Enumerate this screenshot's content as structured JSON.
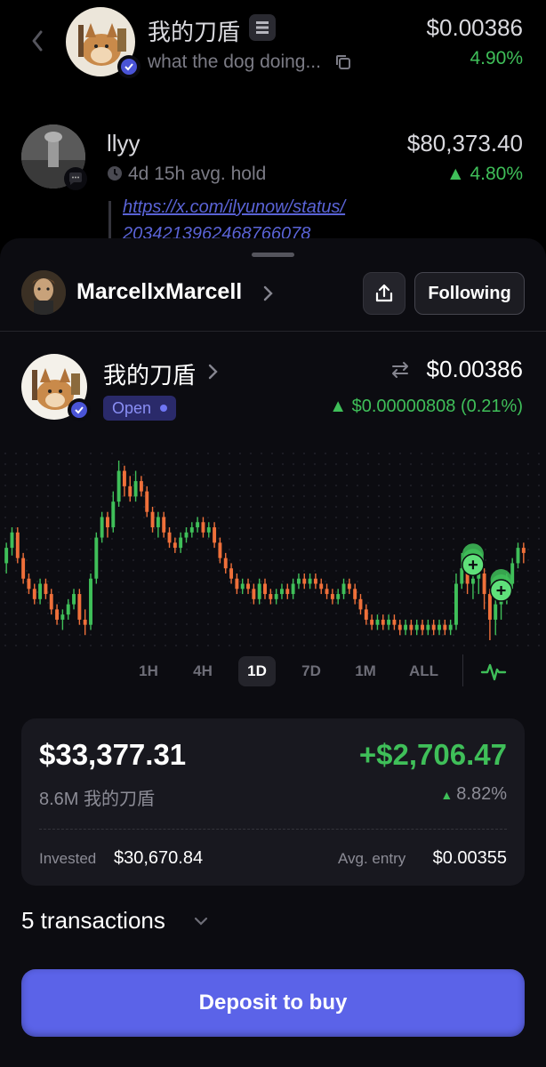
{
  "feed": {
    "items": [
      {
        "title": "我的刀盾",
        "subtitle": "what the dog doing...",
        "price": "$0.00386",
        "change": "4.90%"
      },
      {
        "title": "llyy",
        "subtitle": "4d 15h avg. hold",
        "price": "$80,373.40",
        "change": "▲ 4.80%",
        "link_line1": "https://x.com/ilyunow/status/",
        "link_line2": "2034213962468766078"
      }
    ]
  },
  "sheet": {
    "user": {
      "name": "MarcellxMarcell",
      "follow_label": "Following"
    },
    "token": {
      "name": "我的刀盾",
      "status": "Open",
      "price": "$0.00386",
      "delta": "▲ $0.00000808 (0.21%)"
    },
    "ranges": [
      "1H",
      "4H",
      "1D",
      "7D",
      "1M",
      "ALL"
    ],
    "active_range": "1D",
    "position": {
      "value": "$33,377.31",
      "pnl": "+$2,706.47",
      "amount": "8.6M 我的刀盾",
      "pnl_pct": "8.82%",
      "invested_label": "Invested",
      "invested": "$30,670.84",
      "avg_entry_label": "Avg. entry",
      "avg_entry": "$0.00355"
    },
    "transactions_label": "5 transactions",
    "deposit_label": "Deposit to buy"
  },
  "colors": {
    "accent": "#5b63e8",
    "up": "#3fbf59",
    "down": "#f0703a",
    "sheet_bg": "#0c0c11",
    "card_bg": "#18181f"
  },
  "icons": [
    "back-chevron-icon",
    "solana-icon",
    "copy-icon",
    "clock-icon",
    "chat-bubble-icon",
    "verified-icon",
    "chevron-right-icon",
    "share-icon",
    "swap-icon",
    "pulse-icon",
    "chevron-down-icon",
    "buy-marker-icon"
  ],
  "chart_data": {
    "type": "candlestick",
    "timeframe": "1D",
    "y_unit": "price index (relative)",
    "candles": [
      [
        52,
        58,
        48,
        60
      ],
      [
        58,
        64,
        55,
        66
      ],
      [
        64,
        54,
        52,
        66
      ],
      [
        54,
        46,
        44,
        56
      ],
      [
        46,
        42,
        40,
        48
      ],
      [
        42,
        38,
        36,
        44
      ],
      [
        38,
        44,
        36,
        46
      ],
      [
        44,
        40,
        38,
        46
      ],
      [
        40,
        34,
        32,
        42
      ],
      [
        34,
        30,
        28,
        36
      ],
      [
        30,
        32,
        26,
        34
      ],
      [
        32,
        36,
        30,
        38
      ],
      [
        36,
        40,
        34,
        42
      ],
      [
        40,
        30,
        28,
        42
      ],
      [
        30,
        28,
        24,
        34
      ],
      [
        28,
        46,
        26,
        48
      ],
      [
        46,
        62,
        44,
        64
      ],
      [
        62,
        70,
        60,
        72
      ],
      [
        70,
        66,
        62,
        72
      ],
      [
        66,
        76,
        64,
        80
      ],
      [
        76,
        88,
        74,
        92
      ],
      [
        88,
        82,
        78,
        90
      ],
      [
        82,
        78,
        76,
        86
      ],
      [
        78,
        84,
        76,
        88
      ],
      [
        84,
        80,
        78,
        86
      ],
      [
        80,
        72,
        70,
        82
      ],
      [
        72,
        66,
        64,
        74
      ],
      [
        66,
        70,
        62,
        72
      ],
      [
        70,
        64,
        62,
        72
      ],
      [
        64,
        60,
        58,
        66
      ],
      [
        60,
        58,
        56,
        62
      ],
      [
        58,
        62,
        56,
        64
      ],
      [
        62,
        64,
        60,
        66
      ],
      [
        64,
        66,
        62,
        68
      ],
      [
        66,
        68,
        64,
        70
      ],
      [
        68,
        64,
        62,
        70
      ],
      [
        64,
        66,
        62,
        68
      ],
      [
        66,
        60,
        58,
        68
      ],
      [
        60,
        54,
        52,
        62
      ],
      [
        54,
        50,
        48,
        56
      ],
      [
        50,
        46,
        44,
        52
      ],
      [
        46,
        42,
        40,
        48
      ],
      [
        42,
        44,
        40,
        46
      ],
      [
        44,
        42,
        40,
        46
      ],
      [
        42,
        38,
        36,
        44
      ],
      [
        38,
        44,
        36,
        46
      ],
      [
        44,
        40,
        38,
        46
      ],
      [
        40,
        38,
        36,
        42
      ],
      [
        38,
        40,
        36,
        42
      ],
      [
        40,
        42,
        38,
        44
      ],
      [
        42,
        40,
        38,
        44
      ],
      [
        40,
        44,
        38,
        46
      ],
      [
        44,
        46,
        42,
        48
      ],
      [
        46,
        44,
        42,
        48
      ],
      [
        44,
        46,
        42,
        48
      ],
      [
        46,
        44,
        42,
        48
      ],
      [
        44,
        42,
        40,
        46
      ],
      [
        42,
        40,
        38,
        44
      ],
      [
        40,
        38,
        36,
        42
      ],
      [
        38,
        40,
        36,
        42
      ],
      [
        40,
        44,
        38,
        46
      ],
      [
        44,
        42,
        40,
        46
      ],
      [
        42,
        38,
        36,
        44
      ],
      [
        38,
        34,
        32,
        40
      ],
      [
        34,
        30,
        28,
        36
      ],
      [
        30,
        28,
        26,
        32
      ],
      [
        28,
        30,
        26,
        32
      ],
      [
        30,
        28,
        26,
        32
      ],
      [
        28,
        30,
        26,
        32
      ],
      [
        30,
        28,
        26,
        32
      ],
      [
        28,
        26,
        24,
        30
      ],
      [
        26,
        28,
        24,
        30
      ],
      [
        28,
        26,
        24,
        30
      ],
      [
        26,
        28,
        24,
        30
      ],
      [
        28,
        26,
        24,
        30
      ],
      [
        26,
        28,
        24,
        30
      ],
      [
        28,
        26,
        24,
        30
      ],
      [
        26,
        28,
        24,
        30
      ],
      [
        28,
        26,
        24,
        30
      ],
      [
        26,
        28,
        24,
        30
      ],
      [
        28,
        44,
        26,
        48
      ],
      [
        44,
        50,
        42,
        56
      ],
      [
        50,
        44,
        40,
        52
      ],
      [
        44,
        46,
        38,
        50
      ],
      [
        46,
        48,
        40,
        52
      ],
      [
        48,
        40,
        34,
        50
      ],
      [
        40,
        30,
        22,
        42
      ],
      [
        30,
        36,
        24,
        38
      ],
      [
        36,
        38,
        30,
        40
      ],
      [
        38,
        44,
        36,
        48
      ],
      [
        44,
        52,
        42,
        54
      ],
      [
        52,
        58,
        50,
        60
      ],
      [
        58,
        56,
        52,
        60
      ]
    ],
    "buy_markers_at": [
      83,
      88
    ]
  }
}
